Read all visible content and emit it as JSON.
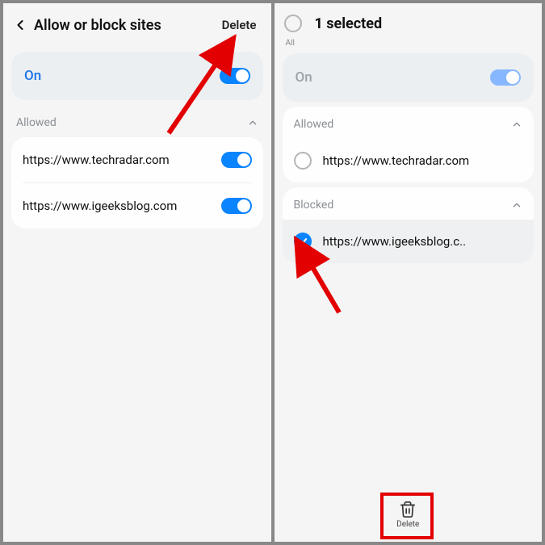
{
  "left": {
    "title": "Allow or block sites",
    "delete_label": "Delete",
    "on_label": "On",
    "allowed_label": "Allowed",
    "sites": [
      {
        "url": "https://www.techradar.com"
      },
      {
        "url": "https://www.igeeksblog.com"
      }
    ]
  },
  "right": {
    "all_label": "All",
    "title": "1 selected",
    "on_label": "On",
    "allowed_label": "Allowed",
    "blocked_label": "Blocked",
    "allowed_sites": [
      {
        "url": "https://www.techradar.com"
      }
    ],
    "blocked_sites": [
      {
        "url": "https://www.igeeksblog.c.."
      }
    ],
    "delete_label": "Delete"
  }
}
